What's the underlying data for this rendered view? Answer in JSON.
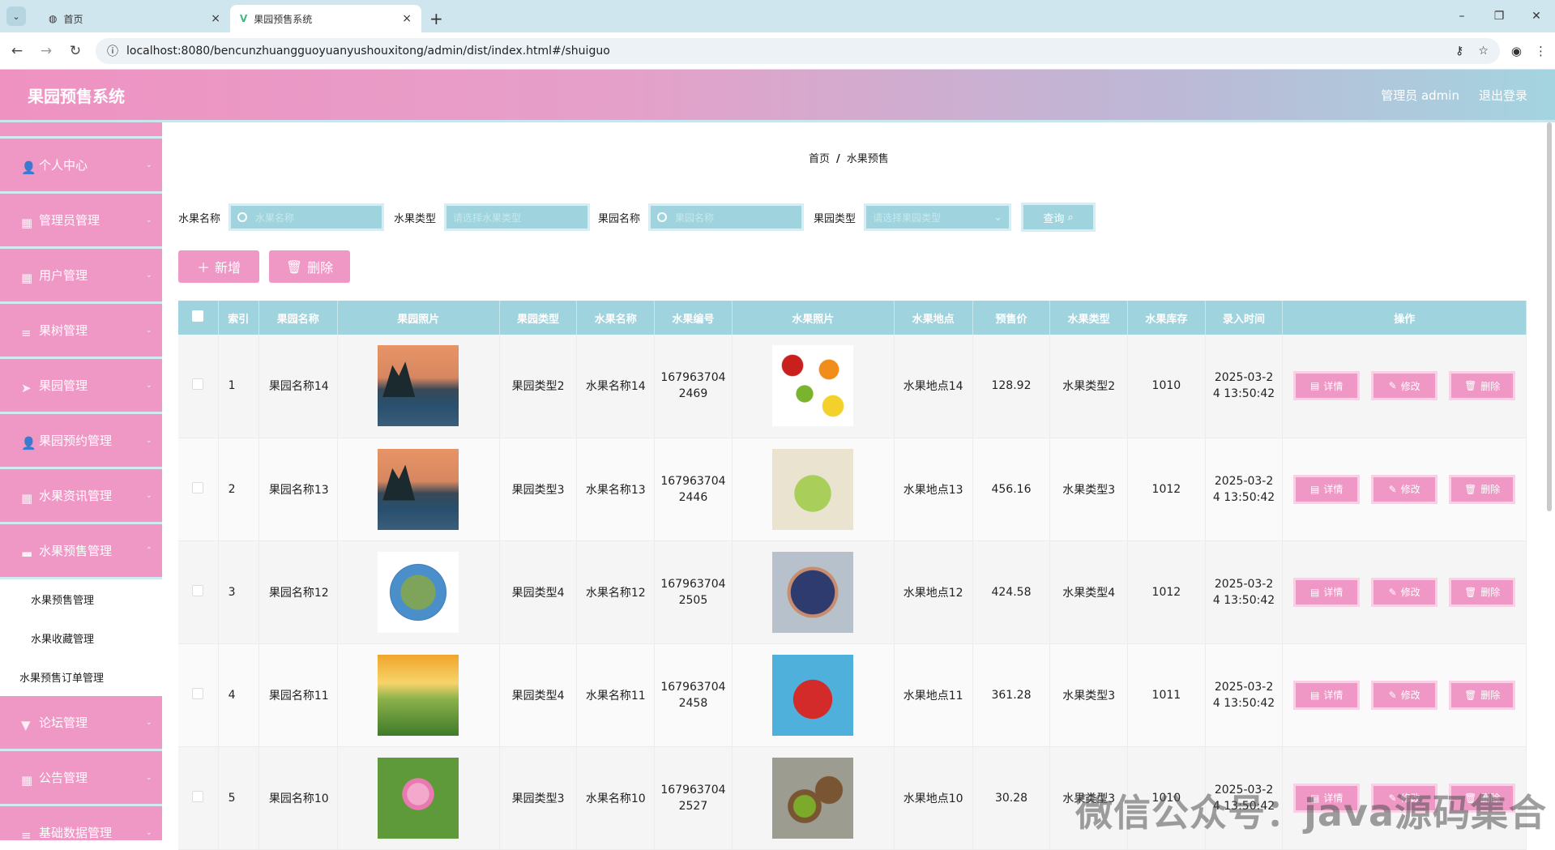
{
  "browser": {
    "tabs": [
      {
        "title": "首页",
        "active": false
      },
      {
        "title": "果园预售系统",
        "active": true
      }
    ],
    "url": "localhost:8080/bencunzhuangguoyuanyushouxitong/admin/dist/index.html#/shuiguo"
  },
  "header": {
    "title": "果园预售系统",
    "user": "管理员 admin",
    "logout": "退出登录"
  },
  "sidebar": {
    "items": [
      {
        "label": "个人中心"
      },
      {
        "label": "管理员管理"
      },
      {
        "label": "用户管理"
      },
      {
        "label": "果树管理"
      },
      {
        "label": "果园管理"
      },
      {
        "label": "果园预约管理"
      },
      {
        "label": "水果资讯管理"
      },
      {
        "label": "水果预售管理"
      }
    ],
    "subitems": [
      "水果预售管理",
      "水果收藏管理"
    ],
    "extra": "水果预售订单管理",
    "items_after": [
      {
        "label": "论坛管理"
      },
      {
        "label": "公告管理"
      },
      {
        "label": "基础数据管理"
      }
    ]
  },
  "breadcrumb": {
    "home": "首页",
    "sep": "/",
    "current": "水果预售"
  },
  "search": {
    "fruit_name_label": "水果名称",
    "fruit_name_placeholder": "水果名称",
    "fruit_type_label": "水果类型",
    "fruit_type_placeholder": "请选择水果类型",
    "orchard_name_label": "果园名称",
    "orchard_name_placeholder": "果园名称",
    "orchard_type_label": "果园类型",
    "orchard_type_placeholder": "请选择果园类型",
    "query_label": "查询"
  },
  "actions": {
    "add": "新增",
    "delete": "删除"
  },
  "table": {
    "headers": [
      "索引",
      "果园名称",
      "果园照片",
      "果园类型",
      "水果名称",
      "水果编号",
      "水果照片",
      "水果地点",
      "预售价",
      "水果类型",
      "水果库存",
      "录入时间",
      "操作"
    ],
    "op_detail": "详情",
    "op_edit": "修改",
    "op_delete": "删除",
    "rows": [
      {
        "index": "1",
        "orchard": "果园名称14",
        "orchard_img": "img-lake",
        "orchard_type": "果园类型2",
        "fruit": "水果名称14",
        "code1": "167963704",
        "code2": "2469",
        "fruit_img": "img-fruitmix",
        "place": "水果地点14",
        "price": "128.92",
        "fruit_type": "水果类型2",
        "stock": "1010",
        "time1": "2025-03-2",
        "time2": "4 13:50:42"
      },
      {
        "index": "2",
        "orchard": "果园名称13",
        "orchard_img": "img-lake",
        "orchard_type": "果园类型3",
        "fruit": "水果名称13",
        "code1": "167963704",
        "code2": "2446",
        "fruit_img": "img-grape",
        "place": "水果地点13",
        "price": "456.16",
        "fruit_type": "水果类型3",
        "stock": "1012",
        "time1": "2025-03-2",
        "time2": "4 13:50:42"
      },
      {
        "index": "3",
        "orchard": "果园名称12",
        "orchard_img": "img-planet",
        "orchard_type": "果园类型4",
        "fruit": "水果名称12",
        "code1": "167963704",
        "code2": "2505",
        "fruit_img": "img-blue",
        "place": "水果地点12",
        "price": "424.58",
        "fruit_type": "水果类型4",
        "stock": "1012",
        "time1": "2025-03-2",
        "time2": "4 13:50:42"
      },
      {
        "index": "4",
        "orchard": "果园名称11",
        "orchard_img": "img-flowers",
        "orchard_type": "果园类型4",
        "fruit": "水果名称11",
        "code1": "167963704",
        "code2": "2458",
        "fruit_img": "img-straw",
        "place": "水果地点11",
        "price": "361.28",
        "fruit_type": "水果类型3",
        "stock": "1011",
        "time1": "2025-03-2",
        "time2": "4 13:50:42"
      },
      {
        "index": "5",
        "orchard": "果园名称10",
        "orchard_img": "img-lotus",
        "orchard_type": "果园类型3",
        "fruit": "水果名称10",
        "code1": "167963704",
        "code2": "2527",
        "fruit_img": "img-kiwi",
        "place": "水果地点10",
        "price": "30.28",
        "fruit_type": "水果类型3",
        "stock": "1010",
        "time1": "2025-03-2",
        "time2": "4 13:50:42"
      }
    ]
  },
  "watermark": "微信公众号：java源码集合"
}
